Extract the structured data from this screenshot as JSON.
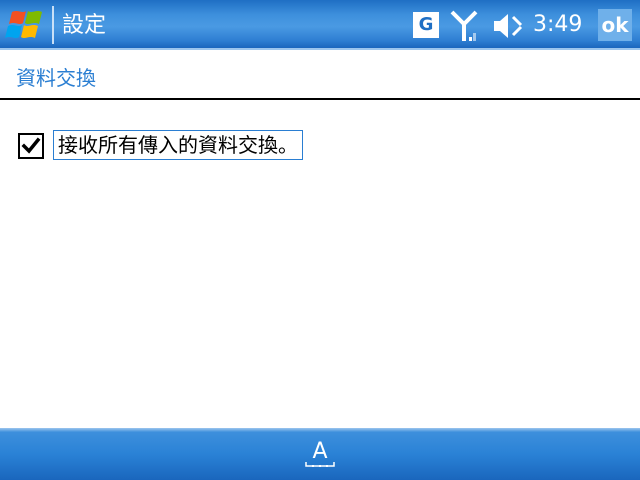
{
  "titlebar": {
    "app_title": "設定",
    "g_label": "G",
    "clock": "3:49",
    "ok_label": "ok",
    "start_icon": "windows-flag-icon",
    "signal_icon": "signal-antenna-icon",
    "volume_icon": "speaker-muted-icon"
  },
  "content": {
    "section_header": "資料交換",
    "checkbox": {
      "label": "接收所有傳入的資料交換。",
      "checked": true
    }
  },
  "bottombar": {
    "sip_label": "A",
    "sip_icon": "input-panel-icon"
  },
  "colors": {
    "accent": "#2a7ed2",
    "titlebar": "#3d8fdc",
    "text": "#000000",
    "background": "#ffffff"
  }
}
